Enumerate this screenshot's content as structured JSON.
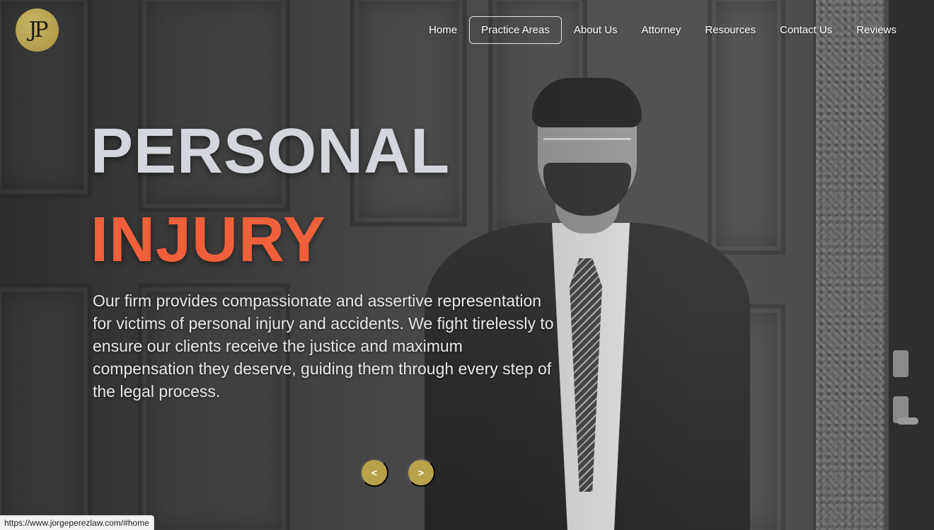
{
  "logo": {
    "text": "JP"
  },
  "nav": {
    "items": [
      {
        "label": "Home"
      },
      {
        "label": "Practice Areas"
      },
      {
        "label": "About Us"
      },
      {
        "label": "Attorney"
      },
      {
        "label": "Resources"
      },
      {
        "label": "Contact Us"
      },
      {
        "label": "Reviews"
      }
    ],
    "active_index": 1
  },
  "hero": {
    "headline_line1": "PERSONAL",
    "headline_line2": "INJURY",
    "blurb": "Our firm provides compassionate and assertive representation for victims of personal injury and accidents. We fight tirelessly to ensure our clients receive the justice and maximum compensation they deserve, guiding them through every step of the legal process."
  },
  "carousel": {
    "prev_label": "<",
    "next_label": ">"
  },
  "status_bar": {
    "url": "https://www.jorgeperezlaw.com/#home"
  },
  "colors": {
    "accent_orange": "#f0603a",
    "gold": "#b8a24a",
    "headline_gray": "#d3d6dc"
  }
}
